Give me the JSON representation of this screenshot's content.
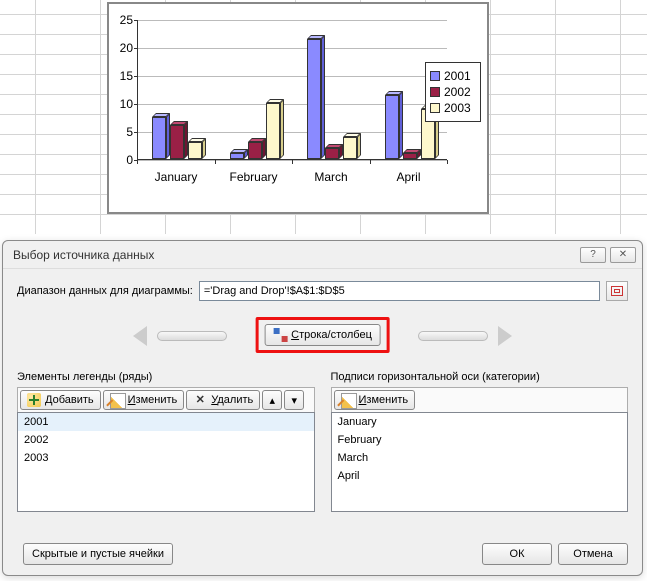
{
  "chart_data": {
    "type": "bar",
    "categories": [
      "January",
      "February",
      "March",
      "April"
    ],
    "series": [
      {
        "name": "2001",
        "values": [
          7.5,
          1,
          21.5,
          11.5
        ],
        "color": "#8a8aff",
        "colorTop": "#b8b8ff",
        "colorSide": "#6060d8"
      },
      {
        "name": "2002",
        "values": [
          6,
          3,
          2,
          1
        ],
        "color": "#9a2046",
        "colorTop": "#c24a72",
        "colorSide": "#6e1532"
      },
      {
        "name": "2003",
        "values": [
          3,
          10,
          4,
          9
        ],
        "color": "#fef8cc",
        "colorTop": "#fffde8",
        "colorSide": "#d8cf8c"
      }
    ],
    "ylim": [
      0,
      25
    ],
    "ystep": 5,
    "legend_position": "right"
  },
  "dialog": {
    "title": "Выбор источника данных",
    "range_label": "Диапазон данных для диаграммы:",
    "range_value": "='Drag and Drop'!$A$1:$D$5",
    "switch_label": "Строка/столбец",
    "legend_section": "Элементы легенды (ряды)",
    "axis_section": "Подписи горизонтальной оси (категории)",
    "buttons": {
      "add": "Добавить",
      "edit": "Изменить",
      "delete": "Удалить",
      "edit_axis": "Изменить",
      "hidden": "Скрытые и пустые ячейки",
      "ok": "ОК",
      "cancel": "Отмена"
    },
    "series_list": [
      "2001",
      "2002",
      "2003"
    ],
    "axis_list": [
      "January",
      "February",
      "March",
      "April"
    ]
  }
}
